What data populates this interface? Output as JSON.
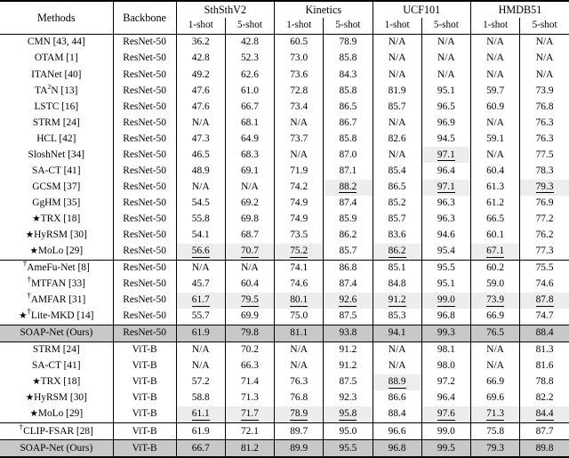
{
  "table": {
    "headers": {
      "methods": "Methods",
      "backbone": "Backbone",
      "datasets": [
        "SthSthV2",
        "Kinetics",
        "UCF101",
        "HMDB51"
      ],
      "shots": [
        "1-shot",
        "5-shot"
      ]
    },
    "symbols": {
      "star": "★",
      "dagger": "†"
    },
    "sections": [
      {
        "id": "resnet-block-a",
        "rows": [
          {
            "method": "CMN [43, 44]",
            "backbone": "ResNet-50",
            "values": [
              "36.2",
              "42.8",
              "60.5",
              "78.9",
              "N/A",
              "N/A",
              "N/A",
              "N/A"
            ],
            "marks": [
              "",
              "",
              "",
              "",
              "",
              "",
              "",
              ""
            ]
          },
          {
            "method": "OTAM [1]",
            "backbone": "ResNet-50",
            "values": [
              "42.8",
              "52.3",
              "73.0",
              "85.8",
              "N/A",
              "N/A",
              "N/A",
              "N/A"
            ],
            "marks": [
              "",
              "",
              "",
              "",
              "",
              "",
              "",
              ""
            ]
          },
          {
            "method": "ITANet [40]",
            "backbone": "ResNet-50",
            "values": [
              "49.2",
              "62.6",
              "73.6",
              "84.3",
              "N/A",
              "N/A",
              "N/A",
              "N/A"
            ],
            "marks": [
              "",
              "",
              "",
              "",
              "",
              "",
              "",
              ""
            ]
          },
          {
            "method": "TA2N [13]",
            "backbone": "ResNet-50",
            "values": [
              "47.6",
              "61.0",
              "72.8",
              "85.8",
              "81.9",
              "95.1",
              "59.7",
              "73.9"
            ],
            "marks": [
              "",
              "",
              "",
              "",
              "",
              "",
              "",
              ""
            ],
            "superscript": "2"
          },
          {
            "method": "LSTC [16]",
            "backbone": "ResNet-50",
            "values": [
              "47.6",
              "66.7",
              "73.4",
              "86.5",
              "85.7",
              "96.5",
              "60.9",
              "76.8"
            ],
            "marks": [
              "",
              "",
              "",
              "",
              "",
              "",
              "",
              ""
            ]
          },
          {
            "method": "STRM [24]",
            "backbone": "ResNet-50",
            "values": [
              "N/A",
              "68.1",
              "N/A",
              "86.7",
              "N/A",
              "96.9",
              "N/A",
              "76.3"
            ],
            "marks": [
              "",
              "",
              "",
              "",
              "",
              "",
              "",
              ""
            ]
          },
          {
            "method": "HCL [42]",
            "backbone": "ResNet-50",
            "values": [
              "47.3",
              "64.9",
              "73.7",
              "85.8",
              "82.6",
              "94.5",
              "59.1",
              "76.3"
            ],
            "marks": [
              "",
              "",
              "",
              "",
              "",
              "",
              "",
              ""
            ]
          },
          {
            "method": "SloshNet [34]",
            "backbone": "ResNet-50",
            "values": [
              "46.5",
              "68.3",
              "N/A",
              "87.0",
              "N/A",
              "97.1",
              "N/A",
              "77.5"
            ],
            "marks": [
              "",
              "",
              "",
              "",
              "",
              "second",
              "",
              ""
            ]
          },
          {
            "method": "SA-CT [41]",
            "backbone": "ResNet-50",
            "values": [
              "48.9",
              "69.1",
              "71.9",
              "87.1",
              "85.4",
              "96.4",
              "60.4",
              "78.3"
            ],
            "marks": [
              "",
              "",
              "",
              "",
              "",
              "",
              "",
              ""
            ]
          },
          {
            "method": "GCSM [37]",
            "backbone": "ResNet-50",
            "values": [
              "N/A",
              "N/A",
              "74.2",
              "88.2",
              "86.5",
              "97.1",
              "61.3",
              "79.3"
            ],
            "marks": [
              "",
              "",
              "",
              "second",
              "",
              "second",
              "",
              "second"
            ]
          },
          {
            "method": "GgHM [35]",
            "backbone": "ResNet-50",
            "values": [
              "54.5",
              "69.2",
              "74.9",
              "87.4",
              "85.2",
              "96.3",
              "61.2",
              "76.9"
            ],
            "marks": [
              "",
              "",
              "",
              "",
              "",
              "",
              "",
              ""
            ]
          },
          {
            "method": "TRX [18]",
            "backbone": "ResNet-50",
            "prefix": "star",
            "values": [
              "55.8",
              "69.8",
              "74.9",
              "85.9",
              "85.7",
              "96.3",
              "66.5",
              "77.2"
            ],
            "marks": [
              "",
              "",
              "",
              "",
              "",
              "",
              "",
              ""
            ]
          },
          {
            "method": "HyRSM [30]",
            "backbone": "ResNet-50",
            "prefix": "star",
            "values": [
              "54.1",
              "68.7",
              "73.5",
              "86.2",
              "83.6",
              "94.6",
              "60.1",
              "76.2"
            ],
            "marks": [
              "",
              "",
              "",
              "",
              "",
              "",
              "",
              ""
            ]
          },
          {
            "method": "MoLo [29]",
            "backbone": "ResNet-50",
            "prefix": "star",
            "values": [
              "56.6",
              "70.7",
              "75.2",
              "85.7",
              "86.2",
              "95.4",
              "67.1",
              "77.3"
            ],
            "marks": [
              "second",
              "second",
              "second",
              "",
              "second",
              "",
              "second",
              ""
            ]
          }
        ]
      },
      {
        "id": "resnet-block-b",
        "rows": [
          {
            "method": "AmeFu-Net [8]",
            "backbone": "ResNet-50",
            "prefix": "dagger",
            "values": [
              "N/A",
              "N/A",
              "74.1",
              "86.8",
              "85.1",
              "95.5",
              "60.2",
              "75.5"
            ],
            "marks": [
              "",
              "",
              "",
              "",
              "",
              "",
              "",
              ""
            ]
          },
          {
            "method": "MTFAN [33]",
            "backbone": "ResNet-50",
            "prefix": "dagger",
            "values": [
              "45.7",
              "60.4",
              "74.6",
              "87.4",
              "84.8",
              "95.1",
              "59.0",
              "74.6"
            ],
            "marks": [
              "",
              "",
              "",
              "",
              "",
              "",
              "",
              ""
            ]
          },
          {
            "method": "AMFAR [31]",
            "backbone": "ResNet-50",
            "prefix": "dagger",
            "values": [
              "61.7",
              "79.5",
              "80.1",
              "92.6",
              "91.2",
              "99.0",
              "73.9",
              "87.8"
            ],
            "marks": [
              "second",
              "second",
              "second",
              "second",
              "second",
              "second",
              "second",
              "second"
            ]
          },
          {
            "method": "Lite-MKD [14]",
            "backbone": "ResNet-50",
            "prefix": "star-dagger",
            "values": [
              "55.7",
              "69.9",
              "75.0",
              "87.5",
              "85.3",
              "96.8",
              "66.9",
              "74.7"
            ],
            "marks": [
              "",
              "",
              "",
              "",
              "",
              "",
              "",
              ""
            ]
          }
        ]
      },
      {
        "id": "ours-resnet",
        "rows": [
          {
            "method": "SOAP-Net (Ours)",
            "backbone": "ResNet-50",
            "ours": true,
            "values": [
              "61.9",
              "79.8",
              "81.1",
              "93.8",
              "94.1",
              "99.3",
              "76.5",
              "88.4"
            ],
            "marks": [
              "best",
              "best",
              "best",
              "best",
              "best",
              "best",
              "best",
              "best"
            ]
          }
        ]
      },
      {
        "id": "vit-block",
        "rows": [
          {
            "method": "STRM [24]",
            "backbone": "ViT-B",
            "values": [
              "N/A",
              "70.2",
              "N/A",
              "91.2",
              "N/A",
              "98.1",
              "N/A",
              "81.3"
            ],
            "marks": [
              "",
              "",
              "",
              "",
              "",
              "",
              "",
              ""
            ]
          },
          {
            "method": "SA-CT [41]",
            "backbone": "ViT-B",
            "values": [
              "N/A",
              "66.3",
              "N/A",
              "91.2",
              "N/A",
              "98.0",
              "N/A",
              "81.6"
            ],
            "marks": [
              "",
              "",
              "",
              "",
              "",
              "",
              "",
              ""
            ]
          },
          {
            "method": "TRX [18]",
            "backbone": "ViT-B",
            "prefix": "star",
            "values": [
              "57.2",
              "71.4",
              "76.3",
              "87.5",
              "88.9",
              "97.2",
              "66.9",
              "78.8"
            ],
            "marks": [
              "",
              "",
              "",
              "",
              "second",
              "",
              "",
              ""
            ]
          },
          {
            "method": "HyRSM [30]",
            "backbone": "ViT-B",
            "prefix": "star",
            "values": [
              "58.8",
              "71.3",
              "76.8",
              "92.3",
              "86.6",
              "96.4",
              "69.6",
              "82.2"
            ],
            "marks": [
              "",
              "",
              "",
              "",
              "",
              "",
              "",
              ""
            ]
          },
          {
            "method": "MoLo [29]",
            "backbone": "ViT-B",
            "prefix": "star",
            "values": [
              "61.1",
              "71.7",
              "78.9",
              "95.8",
              "88.4",
              "97.6",
              "71.3",
              "84.4"
            ],
            "marks": [
              "second",
              "second",
              "second",
              "second",
              "",
              "second",
              "second",
              "second"
            ]
          }
        ]
      },
      {
        "id": "vit-block-b",
        "rows": [
          {
            "method": "CLIP-FSAR [28]",
            "backbone": "ViT-B",
            "prefix": "dagger",
            "values": [
              "61.9",
              "72.1",
              "89.7",
              "95.0",
              "96.6",
              "99.0",
              "75.8",
              "87.7"
            ],
            "marks": [
              "",
              "",
              "",
              "",
              "",
              "",
              "",
              ""
            ]
          }
        ]
      },
      {
        "id": "ours-vit",
        "rows": [
          {
            "method": "SOAP-Net (Ours)",
            "backbone": "ViT-B",
            "ours": true,
            "values": [
              "66.7",
              "81.2",
              "89.9",
              "95.5",
              "96.8",
              "99.5",
              "79.3",
              "89.8"
            ],
            "marks": [
              "best",
              "best",
              "best",
              "best",
              "best",
              "best",
              "best",
              "best"
            ]
          }
        ]
      }
    ]
  }
}
